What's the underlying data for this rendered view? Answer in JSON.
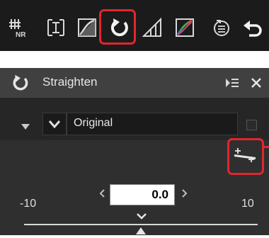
{
  "toolbar": {
    "buttons": [
      {
        "icon": "noise-reduction-icon"
      },
      {
        "icon": "perspective-control-icon"
      },
      {
        "icon": "levels-curves-icon"
      },
      {
        "icon": "straighten-icon",
        "highlighted": true
      },
      {
        "icon": "crop-icon"
      },
      {
        "icon": "color-balance-icon"
      },
      {
        "icon": "adjustment-history-icon"
      },
      {
        "icon": "undo-icon"
      }
    ]
  },
  "panel": {
    "title": "Straighten",
    "preset": {
      "selected": "Original"
    },
    "slider": {
      "min_label": "-10",
      "max_label": "10",
      "value": "0.0",
      "min": -10,
      "max": 10,
      "current": 0
    }
  },
  "colors": {
    "highlight": "#e0262e",
    "toolbar_bg": "#1b1b1b",
    "panel_bg": "#2f2f2f"
  }
}
